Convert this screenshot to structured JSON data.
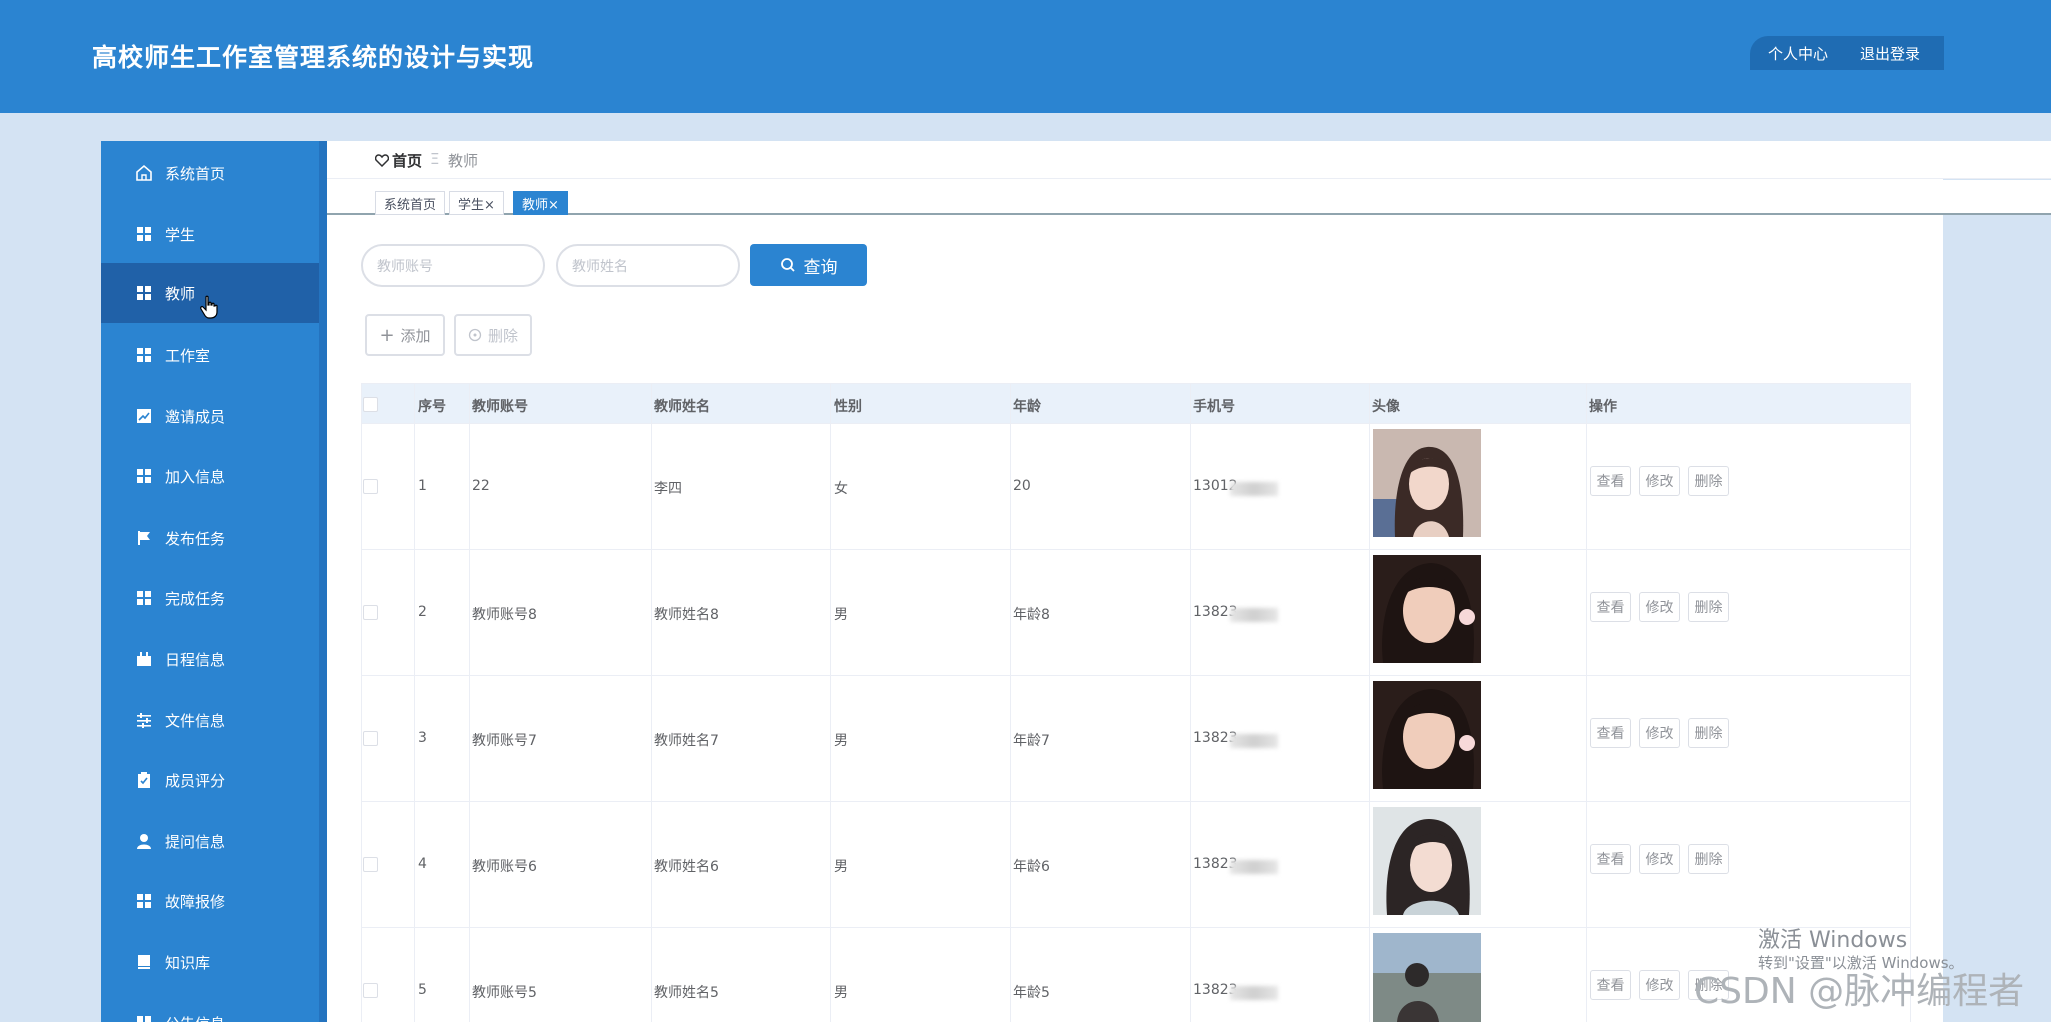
{
  "app": {
    "title": "高校师生工作室管理系统的设计与实现"
  },
  "header": {
    "profile_link": "个人中心",
    "logout_link": "退出登录"
  },
  "sidebar": {
    "items": [
      {
        "label": "系统首页",
        "icon": "home-icon"
      },
      {
        "label": "学生",
        "icon": "grid-icon"
      },
      {
        "label": "教师",
        "icon": "grid-icon",
        "active": true
      },
      {
        "label": "工作室",
        "icon": "grid-icon"
      },
      {
        "label": "邀请成员",
        "icon": "chart-icon"
      },
      {
        "label": "加入信息",
        "icon": "grid-icon"
      },
      {
        "label": "发布任务",
        "icon": "flag-icon"
      },
      {
        "label": "完成任务",
        "icon": "grid-icon"
      },
      {
        "label": "日程信息",
        "icon": "calendar-icon"
      },
      {
        "label": "文件信息",
        "icon": "sliders-icon"
      },
      {
        "label": "成员评分",
        "icon": "clipboard-icon"
      },
      {
        "label": "提问信息",
        "icon": "user-icon"
      },
      {
        "label": "故障报修",
        "icon": "grid-icon"
      },
      {
        "label": "知识库",
        "icon": "book-icon"
      },
      {
        "label": "公告信息",
        "icon": "grid-icon"
      }
    ]
  },
  "breadcrumb": {
    "home": "首页",
    "separator": "Ξ",
    "current": "教师"
  },
  "tags": [
    {
      "label": "系统首页"
    },
    {
      "label": "学生×"
    },
    {
      "label": "教师×",
      "active": true
    }
  ],
  "search": {
    "account_placeholder": "教师账号",
    "name_placeholder": "教师姓名",
    "query_label": "查询"
  },
  "actions": {
    "add_label": "添加",
    "delete_label": "删除"
  },
  "table": {
    "columns": [
      "序号",
      "教师账号",
      "教师姓名",
      "性别",
      "年龄",
      "手机号",
      "头像",
      "操作"
    ],
    "rows": [
      {
        "index": "1",
        "account": "22",
        "name": "李四",
        "gender": "女",
        "age": "20",
        "phone": "13012"
      },
      {
        "index": "2",
        "account": "教师账号8",
        "name": "教师姓名8",
        "gender": "男",
        "age": "年龄8",
        "phone": "13823"
      },
      {
        "index": "3",
        "account": "教师账号7",
        "name": "教师姓名7",
        "gender": "男",
        "age": "年龄7",
        "phone": "13823"
      },
      {
        "index": "4",
        "account": "教师账号6",
        "name": "教师姓名6",
        "gender": "男",
        "age": "年龄6",
        "phone": "13823"
      },
      {
        "index": "5",
        "account": "教师账号5",
        "name": "教师姓名5",
        "gender": "男",
        "age": "年龄5",
        "phone": "13823"
      }
    ],
    "row_actions": {
      "view": "查看",
      "edit": "修改",
      "delete": "删除"
    }
  },
  "watermarks": {
    "windows_title": "激活 Windows",
    "windows_sub": "转到\"设置\"以激活 Windows。",
    "csdn": "CSDN @脉冲编程者"
  },
  "colors": {
    "primary": "#2b84d1",
    "active_menu": "#2061a8",
    "page_bg": "#d4e3f3"
  }
}
